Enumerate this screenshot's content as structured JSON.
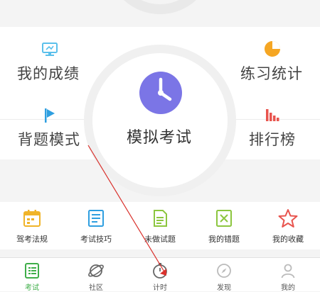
{
  "grid": {
    "scores": "我的成绩",
    "stats": "练习统计",
    "recite": "背题模式",
    "ranking": "排行榜",
    "mock_exam": "模拟考试"
  },
  "tools": [
    {
      "label": "驾考法规",
      "icon": "calendar-icon"
    },
    {
      "label": "考试技巧",
      "icon": "book-icon"
    },
    {
      "label": "未做试题",
      "icon": "document-icon"
    },
    {
      "label": "我的错题",
      "icon": "wrong-box-icon"
    },
    {
      "label": "我的收藏",
      "icon": "star-icon"
    }
  ],
  "tabs": [
    {
      "label": "考试",
      "icon": "list-icon",
      "active": true
    },
    {
      "label": "社区",
      "icon": "planet-icon"
    },
    {
      "label": "计时",
      "icon": "stopwatch-icon"
    },
    {
      "label": "发现",
      "icon": "discover-icon"
    },
    {
      "label": "我的",
      "icon": "user-icon"
    }
  ],
  "colors": {
    "accent_green": "#3fae49",
    "clock_purple": "#7b75e6",
    "orange": "#f5a623",
    "annotation_red": "#d9312c"
  }
}
